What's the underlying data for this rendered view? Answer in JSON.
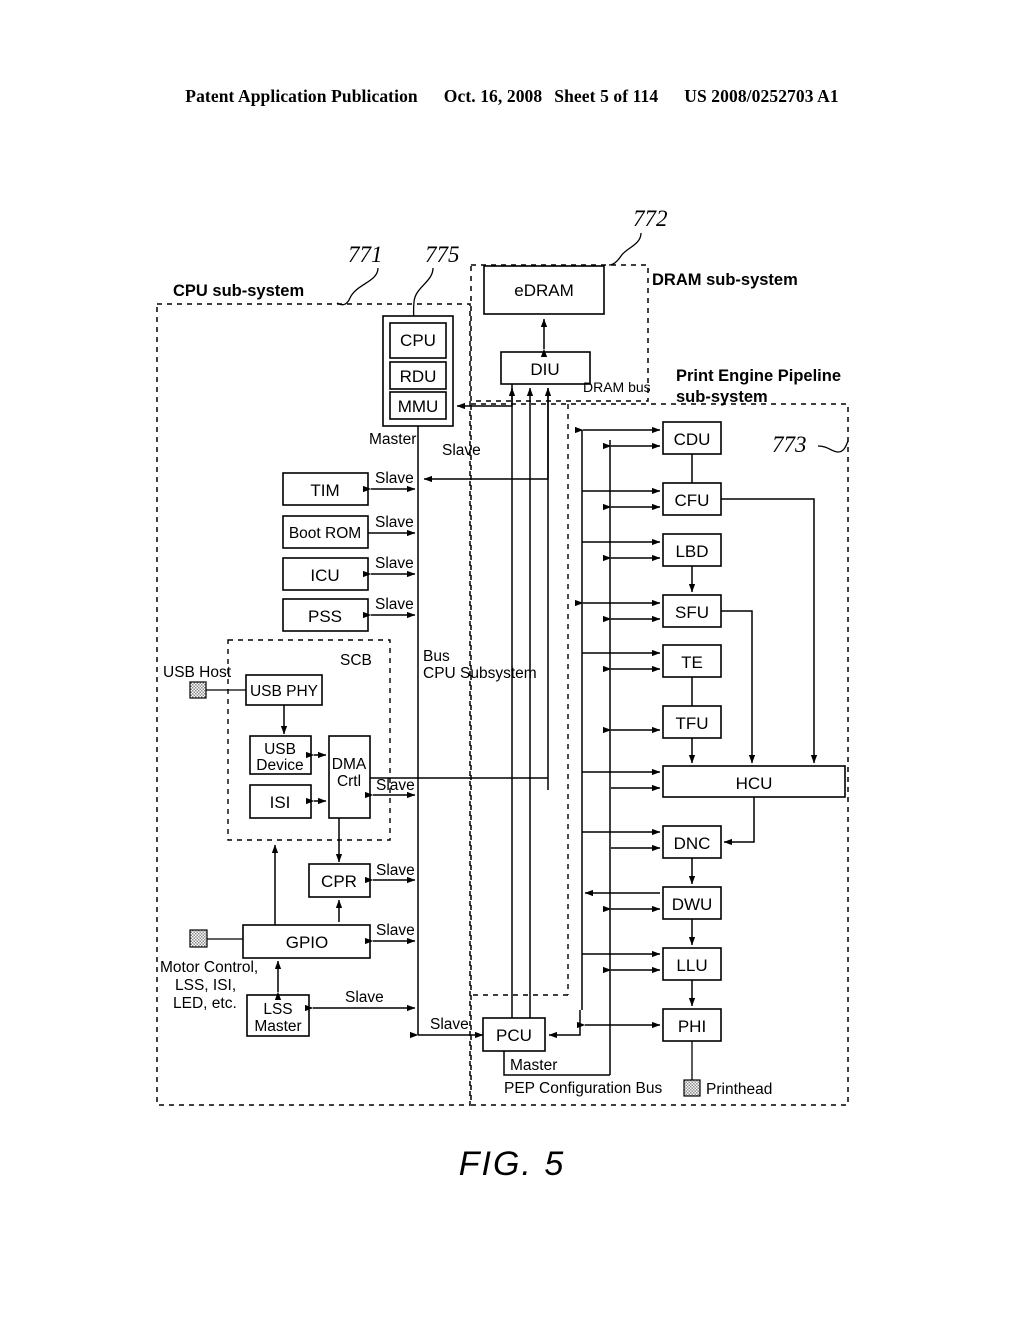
{
  "header": {
    "publication": "Patent Application Publication",
    "date": "Oct. 16, 2008",
    "sheet": "Sheet 5 of 114",
    "docnum": "US 2008/0252703 A1"
  },
  "figure": {
    "caption": "FIG. 5",
    "reference_numerals": [
      "771",
      "775",
      "772",
      "773"
    ]
  },
  "subsystems": {
    "cpu": "CPU sub-system",
    "dram": "DRAM sub-system",
    "pep_line1": "Print Engine Pipeline",
    "pep_line2": "sub-system"
  },
  "blocks": {
    "cpu": "CPU",
    "rdu": "RDU",
    "mmu": "MMU",
    "edram": "eDRAM",
    "diu": "DIU",
    "tim": "TIM",
    "bootrom": "Boot ROM",
    "icu": "ICU",
    "pss": "PSS",
    "usbphy": "USB PHY",
    "usbdevice_l1": "USB",
    "usbdevice_l2": "Device",
    "isi": "ISI",
    "dma_l1": "DMA",
    "dma_l2": "Crtl",
    "cpr": "CPR",
    "gpio": "GPIO",
    "lss_l1": "LSS",
    "lss_l2": "Master",
    "pcu": "PCU",
    "cdu": "CDU",
    "cfu": "CFU",
    "lbd": "LBD",
    "sfu": "SFU",
    "te": "TE",
    "tfu": "TFU",
    "hcu": "HCU",
    "dnc": "DNC",
    "dwu": "DWU",
    "llu": "LLU",
    "phi": "PHI"
  },
  "labels": {
    "master": "Master",
    "slave": "Slave",
    "scb": "SCB",
    "dram_bus": "DRAM bus",
    "bus_l1": "Bus",
    "bus_l2": "CPU Subsystem",
    "usb_host": "USB Host",
    "motor_l1": "Motor Control,",
    "motor_l2": "LSS, ISI,",
    "motor_l3": "LED, etc.",
    "pep_config_bus": "PEP Configuration Bus",
    "printhead": "Printhead"
  },
  "slave_labels": [
    "Slave",
    "Slave",
    "Slave",
    "Slave",
    "Slave",
    "Slave",
    "Slave",
    "Slave",
    "Slave",
    "Slave"
  ],
  "colors": {
    "ink": "#000000",
    "paper": "#ffffff",
    "hatch": "#9a9a9a"
  }
}
